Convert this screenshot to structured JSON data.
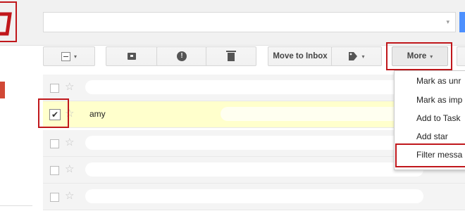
{
  "toolbar": {
    "select_all_caret": "▾",
    "spam_glyph": "!",
    "move_to_inbox_label": "Move to Inbox",
    "labels_caret": "▾",
    "more_label": "More",
    "more_caret": "▾"
  },
  "search": {
    "caret": "▾",
    "button_color": "#4d90fe"
  },
  "emails": [
    {
      "sender": "",
      "selected": false,
      "starred": false
    },
    {
      "sender": "amy",
      "selected": true,
      "starred": false
    },
    {
      "sender": "",
      "selected": false,
      "starred": false
    },
    {
      "sender": "",
      "selected": false,
      "starred": false
    },
    {
      "sender": "",
      "selected": false,
      "starred": false
    }
  ],
  "star_glyph": "☆",
  "check_glyph": "✔",
  "more_menu": {
    "items": [
      "Mark as unr",
      "Mark as imp",
      "Add to Task",
      "Add star",
      "Filter messa"
    ]
  },
  "colors": {
    "highlight": "#c0171b",
    "selected_row": "#ffffcc",
    "inbox_marker": "#d14836"
  },
  "icons": {
    "archive": "archive-icon",
    "spam": "report-spam-icon",
    "delete": "trash-icon",
    "labels": "label-tag-icon",
    "star": "star-icon"
  }
}
